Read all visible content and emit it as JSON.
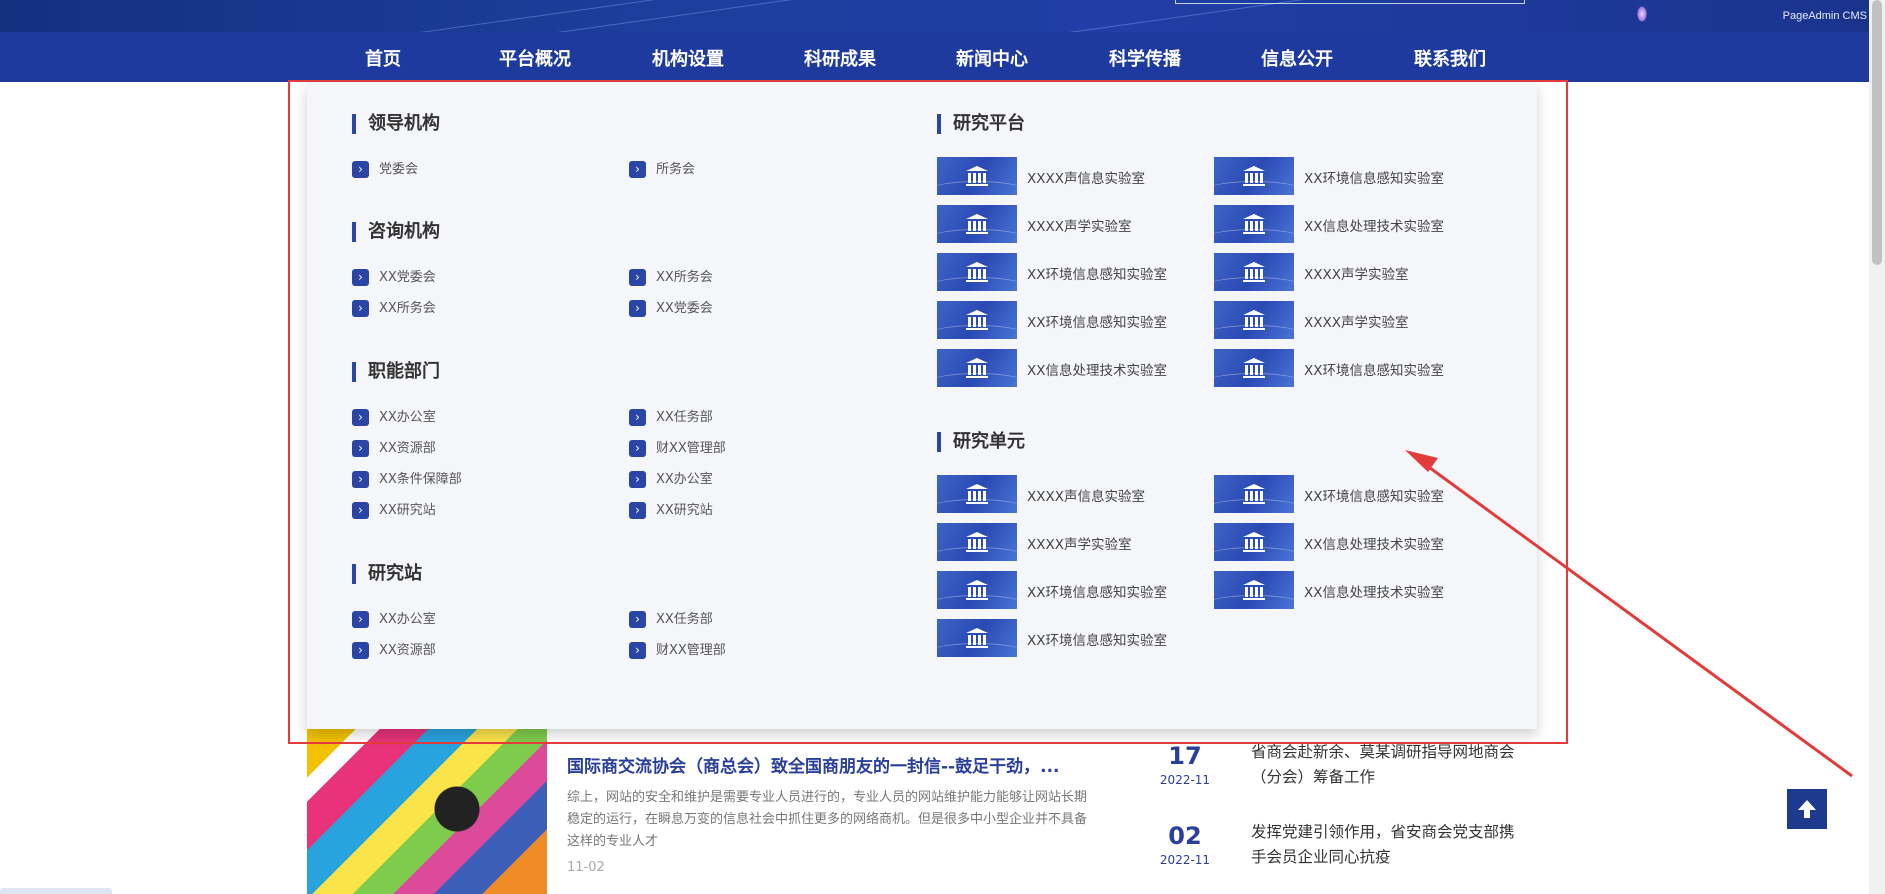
{
  "header": {
    "brand": "PageAdmin CMS",
    "colors": {
      "banner": "#1c3f9d",
      "nav": "#1e3a9f",
      "accent": "#2b45a7",
      "annotation": "#e23b3b"
    }
  },
  "nav": {
    "items": [
      "首页",
      "平台概况",
      "机构设置",
      "科研成果",
      "新闻中心",
      "科学传播",
      "信息公开",
      "联系我们"
    ]
  },
  "menu": {
    "leadership": {
      "title": "领导机构",
      "links": [
        "党委会",
        "所务会"
      ]
    },
    "advisory": {
      "title": "咨询机构",
      "links": [
        "XX党委会",
        "XX所务会",
        "XX所务会",
        "XX党委会"
      ]
    },
    "functional": {
      "title": "职能部门",
      "links": [
        "XX办公室",
        "XX任务部",
        "XX资源部",
        "财XX管理部",
        "XX条件保障部",
        "XX办公室",
        "XX研究站",
        "XX研究站"
      ]
    },
    "stations": {
      "title": "研究站",
      "links": [
        "XX办公室",
        "XX任务部",
        "XX资源部",
        "财XX管理部"
      ]
    },
    "platforms": {
      "title": "研究平台",
      "labs": [
        "XXXX声信息实验室",
        "XX环境信息感知实验室",
        "XXXX声学实验室",
        "XX信息处理技术实验室",
        "XX环境信息感知实验室",
        "XXXX声学实验室",
        "XX环境信息感知实验室",
        "XXXX声学实验室",
        "XX信息处理技术实验室",
        "XX环境信息感知实验室"
      ]
    },
    "units": {
      "title": "研究单元",
      "labs": [
        "XXXX声信息实验室",
        "XX环境信息感知实验室",
        "XXXX声学实验室",
        "XX信息处理技术实验室",
        "XX环境信息感知实验室",
        "XX信息处理技术实验室",
        "XX环境信息感知实验室"
      ]
    },
    "link_icon": "chevron-right-icon",
    "lab_icon": "institution-icon"
  },
  "news": {
    "title": "国际商交流协会（商总会）致全国商朋友的一封信--鼓足干劲，...",
    "desc": "综上，网站的安全和维护是需要专业人员进行的，专业人员的网站维护能力能够让网站长期稳定的运行，在瞬息万变的信息社会中抓住更多的网络商机。但是很多中小型企业并不具备这样的专业人才",
    "date": "11-02"
  },
  "side_news": [
    {
      "day": "17",
      "ym": "2022-11",
      "text": "省商会赴新余、莫某调研指导网地商会（分会）筹备工作"
    },
    {
      "day": "02",
      "ym": "2022-11",
      "text": "发挥党建引领作用，省安商会党支部携手会员企业同心抗疫"
    }
  ],
  "back_to_top_icon": "arrow-up-icon"
}
